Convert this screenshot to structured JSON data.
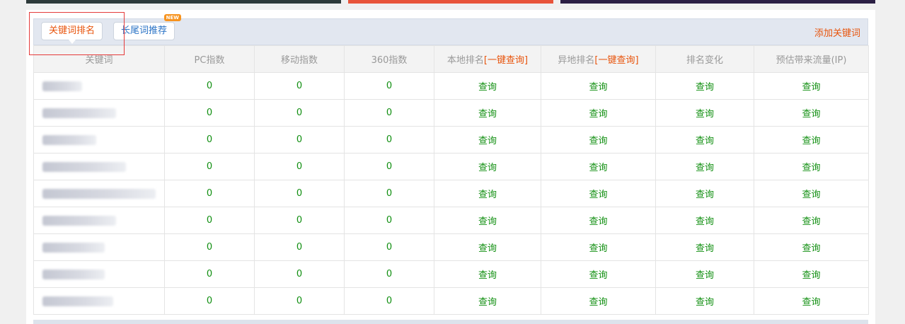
{
  "tabs": [
    {
      "label": "关键词排名"
    },
    {
      "label": "长尾词推荐",
      "badge": "NEW"
    }
  ],
  "add_keyword_label": "添加关键词",
  "table": {
    "headers": [
      {
        "label": "关键词"
      },
      {
        "label": "PC指数"
      },
      {
        "label": "移动指数"
      },
      {
        "label": "360指数"
      },
      {
        "label": "本地排名",
        "link": "[一键查询]"
      },
      {
        "label": "异地排名",
        "link": "[一键查询]"
      },
      {
        "label": "排名变化"
      },
      {
        "label": "预估带来流量(IP)"
      }
    ],
    "rows": [
      {
        "pc": "0",
        "mobile": "0",
        "s360": "0",
        "local": "查询",
        "remote": "查询",
        "change": "查询",
        "traffic": "查询"
      },
      {
        "pc": "0",
        "mobile": "0",
        "s360": "0",
        "local": "查询",
        "remote": "查询",
        "change": "查询",
        "traffic": "查询"
      },
      {
        "pc": "0",
        "mobile": "0",
        "s360": "0",
        "local": "查询",
        "remote": "查询",
        "change": "查询",
        "traffic": "查询"
      },
      {
        "pc": "0",
        "mobile": "0",
        "s360": "0",
        "local": "查询",
        "remote": "查询",
        "change": "查询",
        "traffic": "查询"
      },
      {
        "pc": "0",
        "mobile": "0",
        "s360": "0",
        "local": "查询",
        "remote": "查询",
        "change": "查询",
        "traffic": "查询"
      },
      {
        "pc": "0",
        "mobile": "0",
        "s360": "0",
        "local": "查询",
        "remote": "查询",
        "change": "查询",
        "traffic": "查询"
      },
      {
        "pc": "0",
        "mobile": "0",
        "s360": "0",
        "local": "查询",
        "remote": "查询",
        "change": "查询",
        "traffic": "查询"
      },
      {
        "pc": "0",
        "mobile": "0",
        "s360": "0",
        "local": "查询",
        "remote": "查询",
        "change": "查询",
        "traffic": "查询"
      },
      {
        "pc": "0",
        "mobile": "0",
        "s360": "0",
        "local": "查询",
        "remote": "查询",
        "change": "查询",
        "traffic": "查询"
      }
    ]
  },
  "colors": {
    "accent_orange": "#e8540c",
    "link_blue": "#2a73c6",
    "value_green": "#118f11",
    "highlight_red": "#e53b3b"
  }
}
